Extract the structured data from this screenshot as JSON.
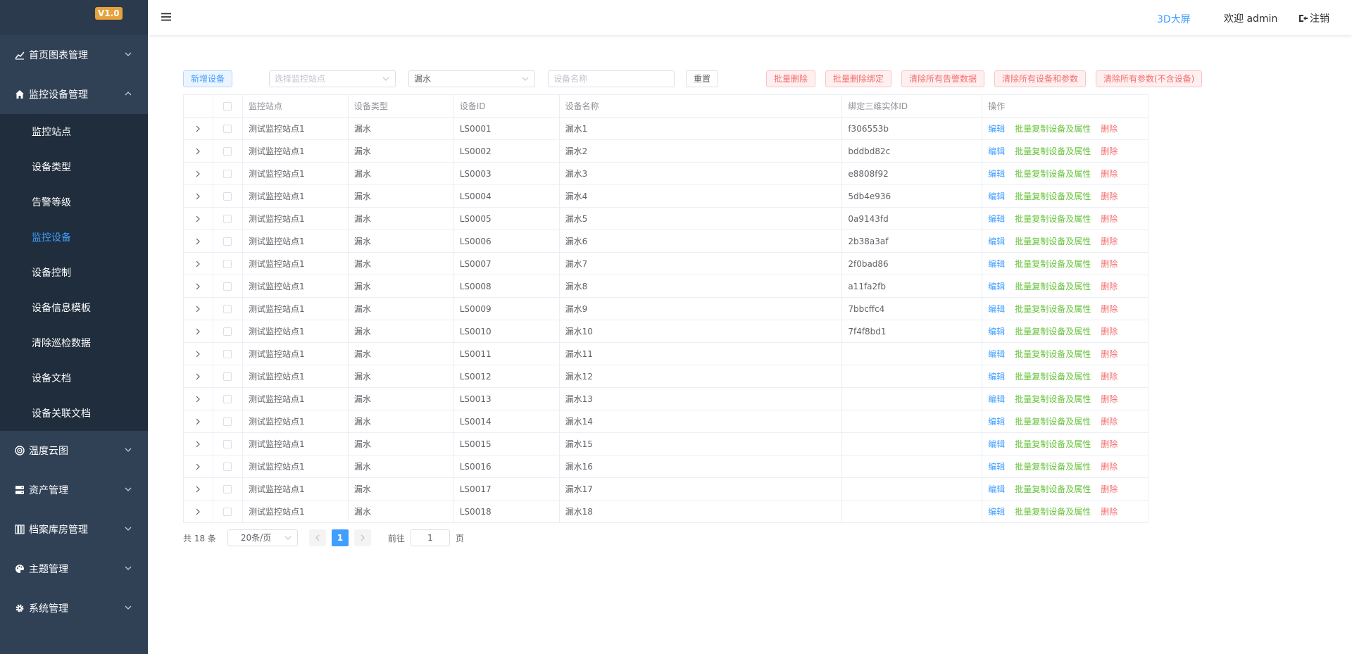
{
  "app": {
    "version": "V1.0"
  },
  "sidebar": {
    "menu": [
      {
        "label": "首页图表管理",
        "icon": "chart-line-icon",
        "open": false
      },
      {
        "label": "监控设备管理",
        "icon": "home-icon",
        "open": true,
        "children": [
          {
            "label": "监控站点",
            "active": false
          },
          {
            "label": "设备类型",
            "active": false
          },
          {
            "label": "告警等级",
            "active": false
          },
          {
            "label": "监控设备",
            "active": true
          },
          {
            "label": "设备控制",
            "active": false
          },
          {
            "label": "设备信息模板",
            "active": false
          },
          {
            "label": "清除巡检数据",
            "active": false
          },
          {
            "label": "设备文档",
            "active": false
          },
          {
            "label": "设备关联文档",
            "active": false
          }
        ]
      },
      {
        "label": "温度云图",
        "icon": "target-icon",
        "open": false
      },
      {
        "label": "资产管理",
        "icon": "server-icon",
        "open": false
      },
      {
        "label": "档案库房管理",
        "icon": "grid-icon",
        "open": false
      },
      {
        "label": "主题管理",
        "icon": "palette-icon",
        "open": false
      },
      {
        "label": "系统管理",
        "icon": "gear-icon",
        "open": false
      }
    ]
  },
  "header": {
    "screen_link": "3D大屏",
    "welcome": "欢迎 admin",
    "logout": "注销"
  },
  "toolbar": {
    "add_button": "新增设备",
    "site_select_placeholder": "选择监控站点",
    "type_select_value": "漏水",
    "name_input_placeholder": "设备名称",
    "reset_button": "重置",
    "batch_delete": "批量删除",
    "batch_unbind": "批量删除绑定",
    "clear_alarms": "清除所有告警数据",
    "clear_devices_params": "清除所有设备和参数",
    "clear_params": "清除所有参数(不含设备)"
  },
  "table": {
    "headers": {
      "site": "监控站点",
      "type": "设备类型",
      "id": "设备ID",
      "name": "设备名称",
      "bind": "绑定三维实体ID",
      "ops": "操作"
    },
    "ops": {
      "edit": "编辑",
      "copy": "批量复制设备及属性",
      "delete": "删除"
    },
    "rows": [
      {
        "site": "测试监控站点1",
        "type": "漏水",
        "id": "LS0001",
        "name": "漏水1",
        "bind": "f306553b"
      },
      {
        "site": "测试监控站点1",
        "type": "漏水",
        "id": "LS0002",
        "name": "漏水2",
        "bind": "bddbd82c"
      },
      {
        "site": "测试监控站点1",
        "type": "漏水",
        "id": "LS0003",
        "name": "漏水3",
        "bind": "e8808f92"
      },
      {
        "site": "测试监控站点1",
        "type": "漏水",
        "id": "LS0004",
        "name": "漏水4",
        "bind": "5db4e936"
      },
      {
        "site": "测试监控站点1",
        "type": "漏水",
        "id": "LS0005",
        "name": "漏水5",
        "bind": "0a9143fd"
      },
      {
        "site": "测试监控站点1",
        "type": "漏水",
        "id": "LS0006",
        "name": "漏水6",
        "bind": "2b38a3af"
      },
      {
        "site": "测试监控站点1",
        "type": "漏水",
        "id": "LS0007",
        "name": "漏水7",
        "bind": "2f0bad86"
      },
      {
        "site": "测试监控站点1",
        "type": "漏水",
        "id": "LS0008",
        "name": "漏水8",
        "bind": "a11fa2fb"
      },
      {
        "site": "测试监控站点1",
        "type": "漏水",
        "id": "LS0009",
        "name": "漏水9",
        "bind": "7bbcffc4"
      },
      {
        "site": "测试监控站点1",
        "type": "漏水",
        "id": "LS0010",
        "name": "漏水10",
        "bind": "7f4f8bd1"
      },
      {
        "site": "测试监控站点1",
        "type": "漏水",
        "id": "LS0011",
        "name": "漏水11",
        "bind": ""
      },
      {
        "site": "测试监控站点1",
        "type": "漏水",
        "id": "LS0012",
        "name": "漏水12",
        "bind": ""
      },
      {
        "site": "测试监控站点1",
        "type": "漏水",
        "id": "LS0013",
        "name": "漏水13",
        "bind": ""
      },
      {
        "site": "测试监控站点1",
        "type": "漏水",
        "id": "LS0014",
        "name": "漏水14",
        "bind": ""
      },
      {
        "site": "测试监控站点1",
        "type": "漏水",
        "id": "LS0015",
        "name": "漏水15",
        "bind": ""
      },
      {
        "site": "测试监控站点1",
        "type": "漏水",
        "id": "LS0016",
        "name": "漏水16",
        "bind": ""
      },
      {
        "site": "测试监控站点1",
        "type": "漏水",
        "id": "LS0017",
        "name": "漏水17",
        "bind": ""
      },
      {
        "site": "测试监控站点1",
        "type": "漏水",
        "id": "LS0018",
        "name": "漏水18",
        "bind": ""
      }
    ]
  },
  "pagination": {
    "total": "共 18 条",
    "page_size": "20条/页",
    "current_page": "1",
    "goto_label": "前往",
    "goto_value": "1",
    "page_suffix": "页"
  },
  "colors": {
    "sidebar_bg": "#304156",
    "submenu_bg": "#1f2d3d",
    "accent": "#409eff",
    "success": "#67c23a",
    "danger": "#f56c6c",
    "version_badge": "#e6a23c"
  }
}
